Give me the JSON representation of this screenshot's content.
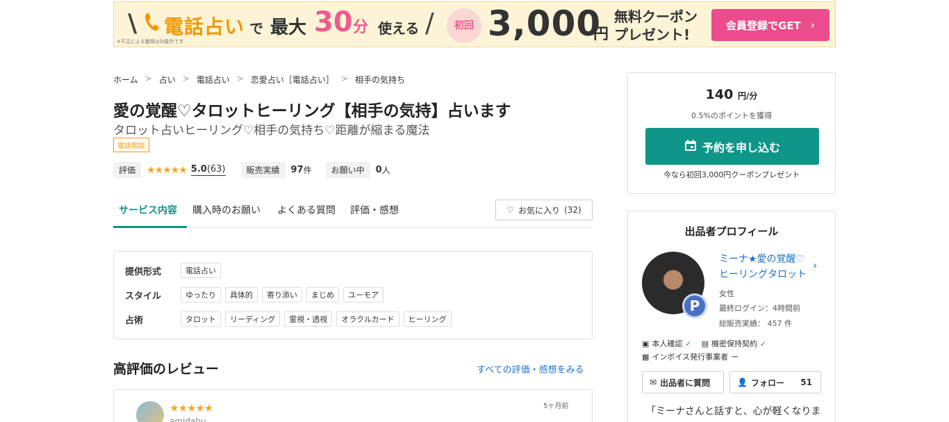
{
  "banner": {
    "tel": "電話占い",
    "de": "で",
    "max": "最大",
    "minutes_num": "30",
    "minutes_unit": "分",
    "use": "使える",
    "first": "初回",
    "amount": "3,000",
    "yen": "円",
    "coupon_line1": "無料クーポン",
    "coupon_line2": "プレゼント!",
    "note": "※不正による獲得は対象外です",
    "cta": "会員登録でGET"
  },
  "breadcrumb": [
    "ホーム",
    "占い",
    "電話占い",
    "恋愛占い［電話占い］",
    "相手の気持ち"
  ],
  "service": {
    "title": "愛の覚醒♡タロットヒーリング【相手の気持】占います",
    "subtitle": "タロット占いヒーリング♡相手の気持ち♡距離が縮まる魔法",
    "tag": "電話相談",
    "rating_label": "評価",
    "stars": "★★★★★",
    "rating": "5.0",
    "rating_count": "(63)",
    "sales_label": "販売実績",
    "sales_value": "97",
    "sales_unit": "件",
    "requests_label": "お願い中",
    "requests_value": "0",
    "requests_unit": "人"
  },
  "tabs": [
    {
      "label": "サービス内容",
      "active": true
    },
    {
      "label": "購入時のお願い",
      "active": false
    },
    {
      "label": "よくある質問",
      "active": false
    },
    {
      "label": "評価・感想",
      "active": false
    }
  ],
  "favorite": {
    "label": "お気に入り",
    "count": "(32)"
  },
  "details": {
    "format_label": "提供形式",
    "format": [
      "電話占い"
    ],
    "style_label": "スタイル",
    "style": [
      "ゆったり",
      "具体的",
      "寄り添い",
      "まじめ",
      "ユーモア"
    ],
    "method_label": "占術",
    "method": [
      "タロット",
      "リーディング",
      "霊視・透視",
      "オラクルカード",
      "ヒーリング"
    ]
  },
  "reviews": {
    "title": "高評価のレビュー",
    "see_all": "すべての評価・感想をみる",
    "first": {
      "stars": "★★★★★",
      "user": "amidabu",
      "date": "5ヶ月前"
    }
  },
  "pricing": {
    "price": "140",
    "unit": "円/分",
    "points": "0.5%のポイントを獲得",
    "reserve": "予約を申し込む",
    "coupon_note": "今なら初回3,000円クーポンプレゼント"
  },
  "profile": {
    "title": "出品者プロフィール",
    "name_line1": "ミーナ★愛の覚醒♡",
    "name_line2": "ヒーリングタロット",
    "gender": "女性",
    "last_login": "最終ログイン：4時間前",
    "total_sales": "総販売実績： 457 件",
    "badge": "P",
    "identity": "本人確認",
    "nda": "機密保持契約",
    "invoice": "インボイス発行事業者",
    "invoice_status": "ー",
    "ask_button": "出品者に質問",
    "follow_button": "フォロー",
    "follow_count": "51",
    "quote": "「ミーナさんと話すと、心が軽くなりま"
  },
  "colors": {
    "accent": "#0f9688",
    "link": "#1a73c9",
    "cta_pink": "#ec4c8b",
    "star": "#f5a623",
    "banner_orange": "#f39800"
  }
}
